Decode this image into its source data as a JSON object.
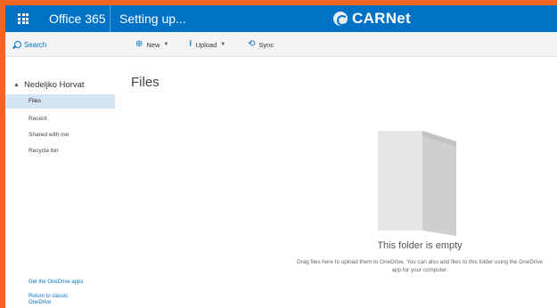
{
  "suite_bar": {
    "app_name": "Office 365",
    "status": "Setting up...",
    "brand": "CARNet",
    "colors": {
      "bar": "#0072c6",
      "frame": "#f26522"
    }
  },
  "command_bar": {
    "search_label": "Search",
    "new_label": "New",
    "upload_label": "Upload",
    "sync_label": "Sync"
  },
  "left_nav": {
    "owner": "Nedeljko Horvat",
    "items": [
      {
        "label": "Files",
        "selected": true
      },
      {
        "label": "Recent",
        "selected": false
      },
      {
        "label": "Shared with me",
        "selected": false
      },
      {
        "label": "Recycle bin",
        "selected": false
      }
    ],
    "get_apps": "Get the OneDrive apps",
    "return_classic": "Return to classic OneDrive"
  },
  "main": {
    "title": "Files",
    "empty_title": "This folder is empty",
    "empty_description": "Drag files here to upload them to OneDrive. You can also add files to this folder using the OneDrive app for your computer."
  }
}
